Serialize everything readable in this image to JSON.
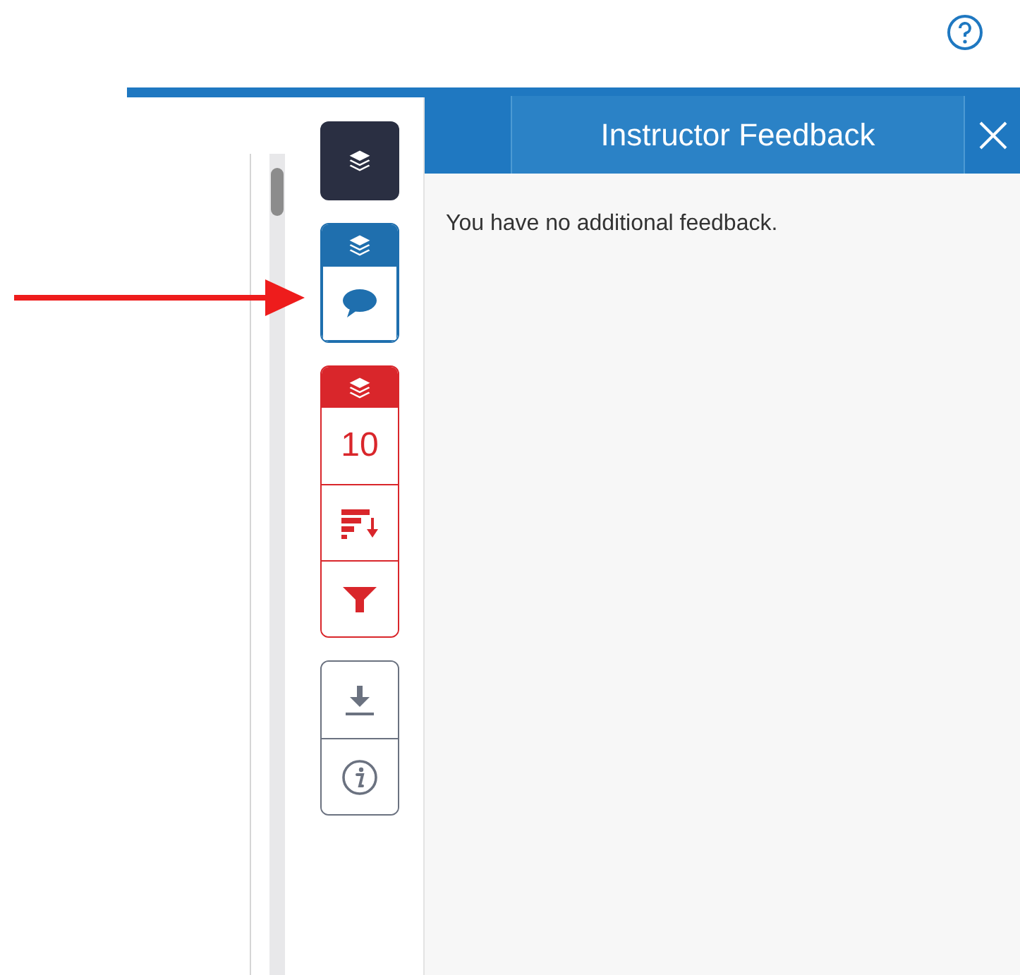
{
  "panel": {
    "title": "Instructor Feedback",
    "message": "You have no additional feedback."
  },
  "tool_groups": [
    {
      "kind": "single",
      "color": "#2a2f42",
      "tools": [
        {
          "kind": "layers"
        }
      ]
    },
    {
      "kind": "tabbed",
      "color": "#1f6fae",
      "tools": [
        {
          "kind": "comment",
          "selected": true
        }
      ]
    },
    {
      "kind": "tabbed",
      "color": "#d9262b",
      "tools": [
        {
          "kind": "count",
          "text": "10"
        },
        {
          "kind": "sort"
        },
        {
          "kind": "filter"
        }
      ]
    },
    {
      "kind": "plain",
      "color": "#6b7280",
      "tools": [
        {
          "kind": "download"
        },
        {
          "kind": "info"
        }
      ]
    }
  ]
}
